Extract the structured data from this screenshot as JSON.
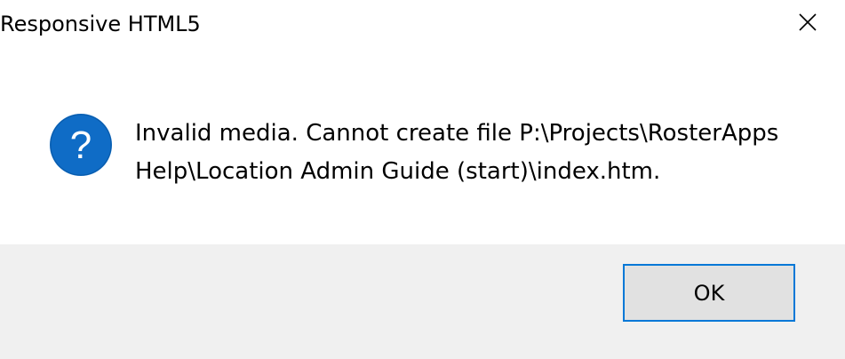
{
  "dialog": {
    "title": "Responsive HTML5",
    "message_line1": "Invalid media. Cannot create file P:\\Projects\\RosterApps",
    "message_line2": "Help\\Location Admin Guide (start)\\index.htm.",
    "icon": "question-icon",
    "close_icon": "close-icon",
    "ok_label": "OK"
  },
  "colors": {
    "icon_blue": "#0f6cc6",
    "button_border": "#0078d7",
    "footer_bg": "#f0f0f0",
    "button_bg": "#e1e1e1"
  }
}
